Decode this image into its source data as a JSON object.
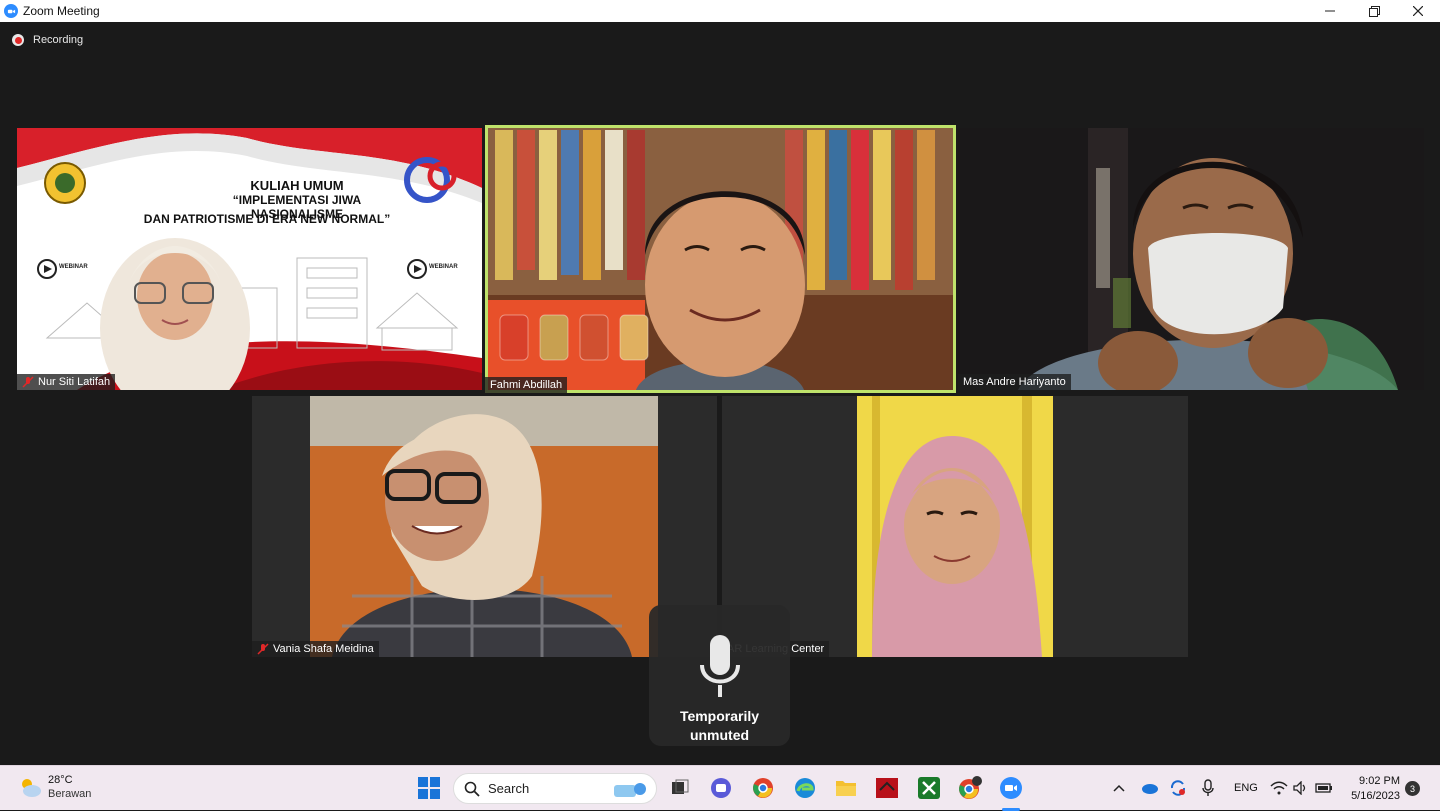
{
  "window": {
    "title": "Zoom Meeting"
  },
  "recording": {
    "label": "Recording"
  },
  "slide": {
    "heading1": "KULIAH UMUM",
    "heading2": "“IMPLEMENTASI JIWA NASIONALISME",
    "heading3": "DAN PATRIOTISME DI ERA NEW NORMAL”",
    "badge": "WEBINAR"
  },
  "participants": [
    {
      "name": "Nur Siti Latifah",
      "muted": true
    },
    {
      "name": "Fahmi Abdillah",
      "muted": false
    },
    {
      "name": "Mas Andre Hariyanto",
      "muted": false
    },
    {
      "name": "Vania Shafa Meidina",
      "muted": true
    },
    {
      "name": "AR Learning Center",
      "muted": false
    }
  ],
  "overlay": {
    "line1": "Temporarily",
    "line2": "unmuted"
  },
  "taskbar": {
    "weather_temp": "28°C",
    "weather_cond": "Berawan",
    "search_label": "Search",
    "lang": "ENG",
    "time": "9:02 PM",
    "date": "5/16/2023",
    "notifications": "3"
  },
  "colors": {
    "accent": "#bfe36b",
    "zoom_blue": "#2d8cff",
    "rec_red": "#e02828"
  }
}
